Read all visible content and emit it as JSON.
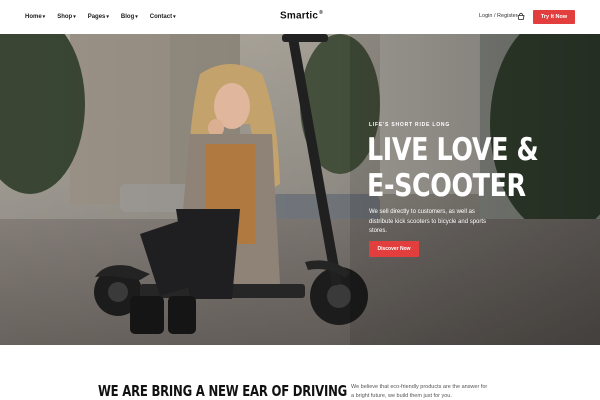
{
  "header": {
    "nav": [
      {
        "label": "Home"
      },
      {
        "label": "Shop"
      },
      {
        "label": "Pages"
      },
      {
        "label": "Blog"
      },
      {
        "label": "Contact"
      }
    ],
    "caret": "▾",
    "logo": "Smartic",
    "logo_mark": "®",
    "login_label": "Login / Register",
    "try_label": "Try It Now"
  },
  "hero": {
    "tagline": "LIFE'S SHORT RIDE LONG",
    "headline_line1": "LIVE LOVE &",
    "headline_line2": "E-SCOOTER",
    "subtext": "We sell directly to customers, as well as distribute kick scooters to bicycle and sports stores.",
    "button_label": "Discover Now"
  },
  "intro": {
    "title": "WE ARE BRING A NEW EAR OF DRIVING",
    "description": "We believe that eco-friendly products are the answer for a bright future, we build them just for you."
  },
  "colors": {
    "accent": "#e33e3e",
    "text": "#1d1d1d",
    "background": "#ffffff"
  },
  "icons": {
    "cart": "shopping-basket-icon"
  }
}
